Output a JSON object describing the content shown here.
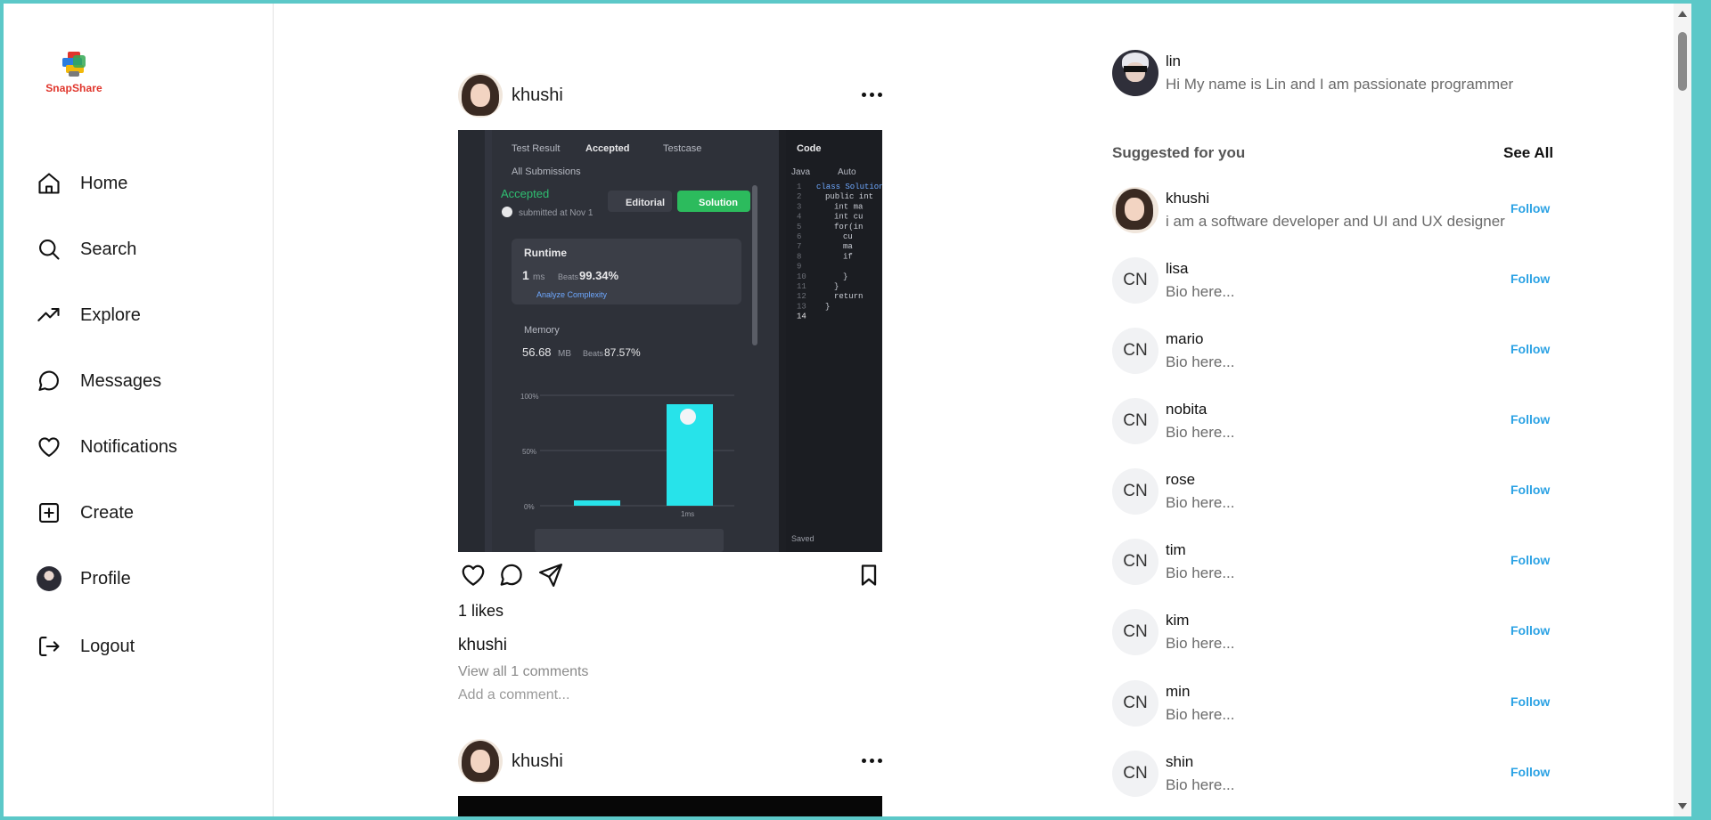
{
  "app": {
    "name": "SnapShare",
    "brand_color": "#e0352b",
    "accent_color": "#2ba2e4"
  },
  "sidebar": {
    "items": [
      {
        "label": "Home",
        "icon": "home-icon"
      },
      {
        "label": "Search",
        "icon": "search-icon"
      },
      {
        "label": "Explore",
        "icon": "trending-up-icon"
      },
      {
        "label": "Messages",
        "icon": "message-circle-icon"
      },
      {
        "label": "Notifications",
        "icon": "heart-icon"
      },
      {
        "label": "Create",
        "icon": "plus-square-icon"
      },
      {
        "label": "Profile",
        "icon": "avatar-icon"
      },
      {
        "label": "Logout",
        "icon": "logout-icon"
      }
    ]
  },
  "feed": {
    "posts": [
      {
        "username": "khushi",
        "likes_text": "1 likes",
        "caption_user": "khushi",
        "view_comments": "View all 1 comments",
        "comment_placeholder": "Add a comment...",
        "image": {
          "tabs": [
            "Test Result",
            "Accepted",
            "Testcase"
          ],
          "back_label": "All Submissions",
          "status": "Accepted",
          "submitted": "submitted at Nov 1",
          "editorial_btn": "Editorial",
          "solution_btn": "Solution",
          "runtime_label": "Runtime",
          "runtime_value": "1",
          "runtime_unit": "ms",
          "runtime_beats_label": "Beats",
          "runtime_beats": "99.34%",
          "analyze": "Analyze Complexity",
          "memory_label": "Memory",
          "memory_value": "56.68",
          "memory_unit": "MB",
          "memory_beats_label": "Beats",
          "memory_beats": "87.57%",
          "axis": [
            "100%",
            "50%",
            "0%"
          ],
          "bar_label": "1ms",
          "code_title": "Code",
          "lang": "Java",
          "auto": "Auto",
          "saved": "Saved",
          "code_lines": [
            "class Solution",
            "public int",
            "int ma",
            "int cu",
            "for(in",
            "cu",
            "ma",
            "if",
            "",
            "}",
            "}",
            "return",
            "}",
            ""
          ],
          "line_numbers": [
            "1",
            "2",
            "3",
            "4",
            "5",
            "6",
            "7",
            "8",
            "9",
            "10",
            "11",
            "12",
            "13",
            "14"
          ]
        }
      },
      {
        "username": "khushi"
      }
    ]
  },
  "right": {
    "me": {
      "username": "lin",
      "bio": "Hi My name is Lin and I am passionate programmer"
    },
    "suggested_title": "Suggested for you",
    "see_all": "See All",
    "follow_label": "Follow",
    "suggestions": [
      {
        "name": "khushi",
        "bio": "i am a software developer and UI and UX designer",
        "initials": ""
      },
      {
        "name": "lisa",
        "bio": "Bio here...",
        "initials": "CN"
      },
      {
        "name": "mario",
        "bio": "Bio here...",
        "initials": "CN"
      },
      {
        "name": "nobita",
        "bio": "Bio here...",
        "initials": "CN"
      },
      {
        "name": "rose",
        "bio": "Bio here...",
        "initials": "CN"
      },
      {
        "name": "tim",
        "bio": "Bio here...",
        "initials": "CN"
      },
      {
        "name": "kim",
        "bio": "Bio here...",
        "initials": "CN"
      },
      {
        "name": "min",
        "bio": "Bio here...",
        "initials": "CN"
      },
      {
        "name": "shin",
        "bio": "Bio here...",
        "initials": "CN"
      }
    ]
  }
}
